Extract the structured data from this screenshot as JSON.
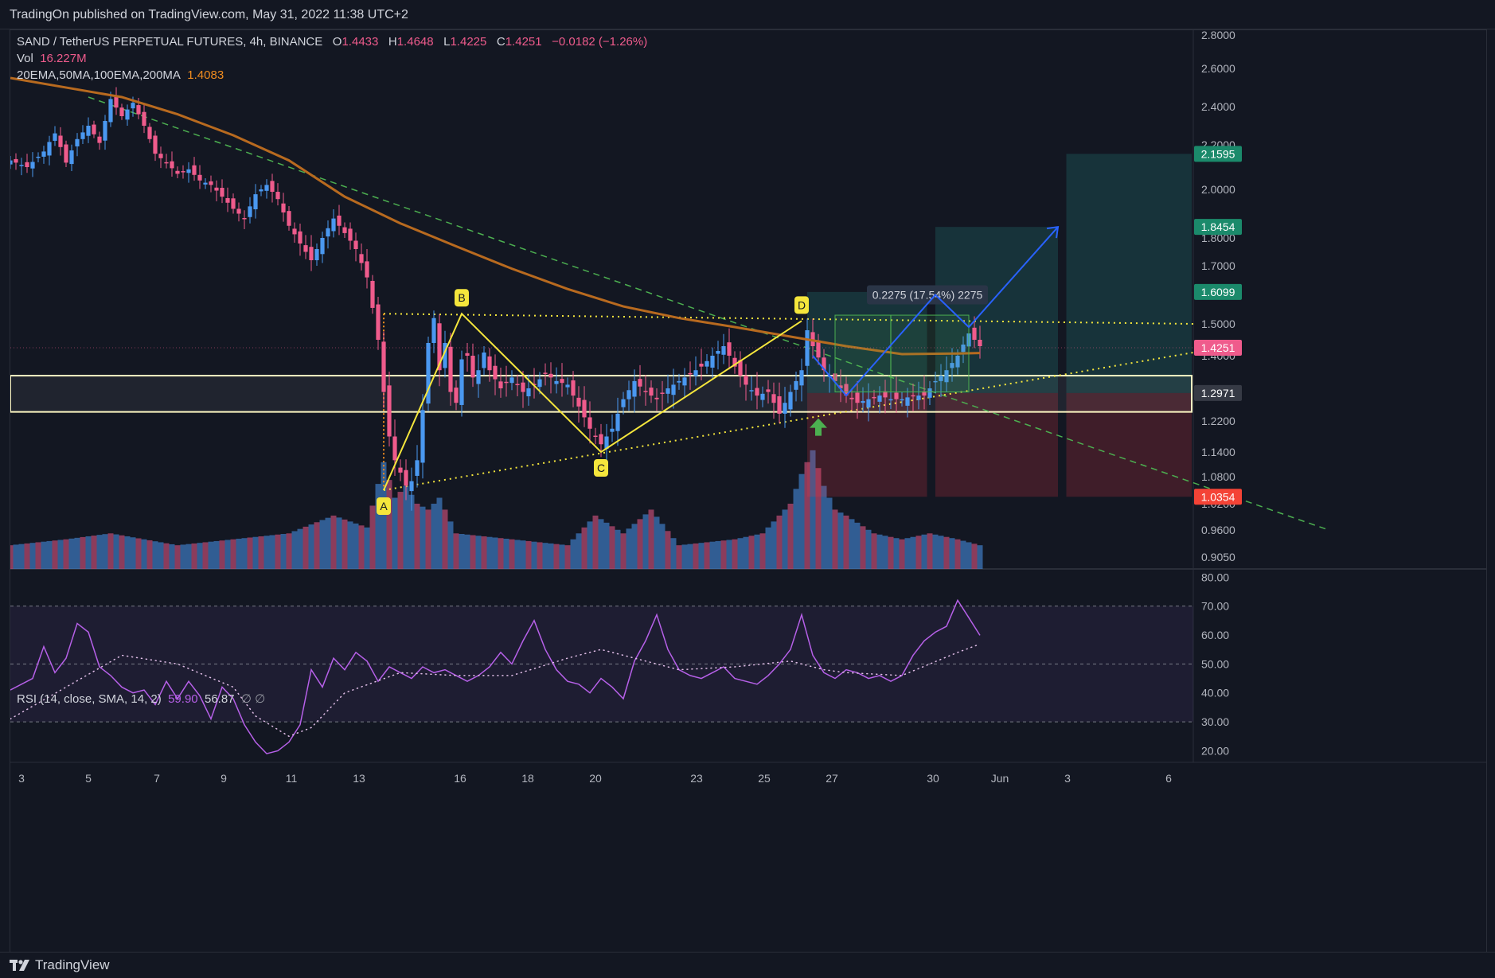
{
  "header": {
    "published_text": "TradingOn published on TradingView.com, May 31, 2022 11:38 UTC+2"
  },
  "legend": {
    "symbol": "SAND / TetherUS PERPETUAL FUTURES, 4h, BINANCE",
    "open_label": "O",
    "open": "1.4433",
    "high_label": "H",
    "high": "1.4648",
    "low_label": "L",
    "low": "1.4225",
    "close_label": "C",
    "close": "1.4251",
    "change": "−0.0182 (−1.26%)",
    "vol_label": "Vol",
    "vol_value": "16.227M",
    "ma_label": "20EMA,50MA,100EMA,200MA",
    "ma_value": "1.4083",
    "rsi_label": "RSI (14, close, SMA, 14, 2)",
    "rsi_value": "59.90",
    "rsi_ma_value": "56.87",
    "rsi_extra": "∅ ∅"
  },
  "footer": {
    "brand": "TradingView"
  },
  "colors": {
    "background": "#131722",
    "up": "#4a98f0",
    "down": "#ef5b8c",
    "ma": "#b86a1f",
    "pattern": "#f5e63c",
    "trend": "#4caf50",
    "rsi": "#b660e8",
    "projection": "#2962ff"
  },
  "chart_data": [
    {
      "type": "candlestick",
      "title": "SAND / TetherUS PERPETUAL FUTURES, 4h, BINANCE",
      "x_ticks": [
        "3",
        "5",
        "7",
        "9",
        "11",
        "13",
        "16",
        "18",
        "20",
        "23",
        "25",
        "27",
        "30",
        "Jun",
        "3",
        "6"
      ],
      "y_ticks": [
        "2.8000",
        "2.6000",
        "2.4000",
        "2.2000",
        "2.0000",
        "1.8000",
        "1.7000",
        "1.5000",
        "1.4000",
        "1.2200",
        "1.1400",
        "1.0800",
        "1.0200",
        "0.9600",
        "0.9050"
      ],
      "y_ticks_values": [
        2.8,
        2.6,
        2.4,
        2.2,
        2.0,
        1.8,
        1.7,
        1.5,
        1.4,
        1.22,
        1.14,
        1.08,
        1.02,
        0.96,
        0.905
      ],
      "ylim": [
        0.88,
        2.87
      ],
      "price_badges": [
        {
          "label": "2.1595",
          "value": 2.1595,
          "color": "#1b8a6b"
        },
        {
          "label": "1.8454",
          "value": 1.8454,
          "color": "#1b8a6b"
        },
        {
          "label": "1.6099",
          "value": 1.6099,
          "color": "#1b8a6b"
        },
        {
          "label": "1.4251",
          "value": 1.4251,
          "color": "#ef5b8c"
        },
        {
          "label": "1.2971",
          "value": 1.2971,
          "color": "#363a45"
        },
        {
          "label": "1.0354",
          "value": 1.0354,
          "color": "#f44336"
        }
      ],
      "close_path": [
        [
          0,
          2.13
        ],
        [
          3,
          2.1
        ],
        [
          6,
          2.17
        ],
        [
          8,
          2.26
        ],
        [
          10,
          2.12
        ],
        [
          12,
          2.23
        ],
        [
          14,
          2.3
        ],
        [
          16,
          2.21
        ],
        [
          18,
          2.44
        ],
        [
          20,
          2.35
        ],
        [
          22,
          2.42
        ],
        [
          24,
          2.3
        ],
        [
          26,
          2.16
        ],
        [
          28,
          2.12
        ],
        [
          30,
          2.07
        ],
        [
          32,
          2.09
        ],
        [
          34,
          2.04
        ],
        [
          36,
          2.02
        ],
        [
          38,
          1.97
        ],
        [
          40,
          1.92
        ],
        [
          42,
          1.88
        ],
        [
          44,
          1.98
        ],
        [
          46,
          2.02
        ],
        [
          48,
          1.96
        ],
        [
          50,
          1.85
        ],
        [
          52,
          1.78
        ],
        [
          54,
          1.72
        ],
        [
          56,
          1.8
        ],
        [
          58,
          1.88
        ],
        [
          60,
          1.82
        ],
        [
          62,
          1.76
        ],
        [
          64,
          1.66
        ],
        [
          66,
          1.45
        ],
        [
          67,
          1.3
        ],
        [
          68,
          1.18
        ],
        [
          69,
          1.12
        ],
        [
          70,
          1.09
        ],
        [
          71,
          1.06
        ],
        [
          72,
          1.07
        ],
        [
          73,
          1.12
        ],
        [
          74,
          1.25
        ],
        [
          75,
          1.44
        ],
        [
          76,
          1.52
        ],
        [
          77,
          1.36
        ],
        [
          78,
          1.44
        ],
        [
          79,
          1.3
        ],
        [
          80,
          1.27
        ],
        [
          81,
          1.39
        ],
        [
          82,
          1.4
        ],
        [
          83,
          1.34
        ],
        [
          84,
          1.36
        ],
        [
          85,
          1.41
        ],
        [
          86,
          1.36
        ],
        [
          88,
          1.31
        ],
        [
          90,
          1.34
        ],
        [
          92,
          1.3
        ],
        [
          94,
          1.32
        ],
        [
          96,
          1.35
        ],
        [
          98,
          1.33
        ],
        [
          100,
          1.32
        ],
        [
          102,
          1.26
        ],
        [
          104,
          1.2
        ],
        [
          106,
          1.16
        ],
        [
          108,
          1.2
        ],
        [
          110,
          1.28
        ],
        [
          112,
          1.33
        ],
        [
          114,
          1.3
        ],
        [
          116,
          1.28
        ],
        [
          118,
          1.31
        ],
        [
          120,
          1.33
        ],
        [
          122,
          1.35
        ],
        [
          124,
          1.37
        ],
        [
          126,
          1.4
        ],
        [
          128,
          1.43
        ],
        [
          130,
          1.37
        ],
        [
          132,
          1.32
        ],
        [
          134,
          1.29
        ],
        [
          136,
          1.3
        ],
        [
          138,
          1.24
        ],
        [
          140,
          1.3
        ],
        [
          142,
          1.36
        ],
        [
          143,
          1.48
        ],
        [
          144,
          1.43
        ],
        [
          146,
          1.36
        ],
        [
          148,
          1.33
        ],
        [
          150,
          1.29
        ],
        [
          152,
          1.27
        ],
        [
          154,
          1.28
        ],
        [
          156,
          1.29
        ],
        [
          158,
          1.28
        ],
        [
          160,
          1.28
        ],
        [
          162,
          1.29
        ],
        [
          164,
          1.29
        ],
        [
          166,
          1.33
        ],
        [
          168,
          1.36
        ],
        [
          170,
          1.4
        ],
        [
          172,
          1.47
        ],
        [
          174,
          1.43
        ]
      ],
      "ma200_path": [
        [
          0,
          2.55
        ],
        [
          14,
          2.48
        ],
        [
          20,
          2.45
        ],
        [
          30,
          2.36
        ],
        [
          40,
          2.25
        ],
        [
          50,
          2.13
        ],
        [
          60,
          1.97
        ],
        [
          70,
          1.86
        ],
        [
          80,
          1.77
        ],
        [
          90,
          1.69
        ],
        [
          100,
          1.62
        ],
        [
          110,
          1.56
        ],
        [
          120,
          1.52
        ],
        [
          130,
          1.49
        ],
        [
          140,
          1.46
        ],
        [
          150,
          1.43
        ],
        [
          160,
          1.405
        ],
        [
          170,
          1.407
        ],
        [
          174,
          1.4083
        ]
      ],
      "volume_path": [
        [
          0,
          0.2
        ],
        [
          10,
          0.25
        ],
        [
          18,
          0.3
        ],
        [
          30,
          0.2
        ],
        [
          40,
          0.25
        ],
        [
          50,
          0.3
        ],
        [
          58,
          0.45
        ],
        [
          64,
          0.35
        ],
        [
          67,
          0.9
        ],
        [
          69,
          0.6
        ],
        [
          71,
          0.7
        ],
        [
          73,
          0.55
        ],
        [
          75,
          0.5
        ],
        [
          77,
          0.6
        ],
        [
          80,
          0.3
        ],
        [
          90,
          0.25
        ],
        [
          100,
          0.2
        ],
        [
          105,
          0.45
        ],
        [
          110,
          0.3
        ],
        [
          115,
          0.5
        ],
        [
          120,
          0.2
        ],
        [
          130,
          0.25
        ],
        [
          135,
          0.3
        ],
        [
          140,
          0.55
        ],
        [
          142,
          0.8
        ],
        [
          144,
          1.0
        ],
        [
          146,
          0.7
        ],
        [
          148,
          0.5
        ],
        [
          150,
          0.45
        ],
        [
          155,
          0.3
        ],
        [
          160,
          0.25
        ],
        [
          165,
          0.3
        ],
        [
          170,
          0.25
        ],
        [
          174,
          0.2
        ]
      ],
      "levels": {
        "zone_top": 1.345,
        "zone_bottom": 1.245,
        "resistance_dotted": 1.535,
        "entry": 1.2971,
        "stop": 1.0354
      },
      "pattern_points": [
        {
          "label": "A",
          "value": 1.05
        },
        {
          "label": "B",
          "value": 1.535
        },
        {
          "label": "C",
          "value": 1.14
        },
        {
          "label": "D",
          "value": 1.51
        }
      ],
      "measure_label": "0.2275 (17.54%) 2275"
    },
    {
      "type": "line",
      "title": "RSI (14, close, SMA, 14, 2)",
      "y_ticks": [
        "80.00",
        "70.00",
        "60.00",
        "50.00",
        "40.00",
        "30.00",
        "20.00"
      ],
      "y_ticks_values": [
        80,
        70,
        60,
        50,
        40,
        30,
        20
      ],
      "ylim": [
        16,
        82
      ],
      "band": [
        30,
        70
      ],
      "series": [
        {
          "name": "RSI",
          "values": [
            [
              0,
              41
            ],
            [
              4,
              45
            ],
            [
              6,
              56
            ],
            [
              8,
              47
            ],
            [
              10,
              52
            ],
            [
              12,
              64
            ],
            [
              14,
              61
            ],
            [
              16,
              49
            ],
            [
              18,
              46
            ],
            [
              20,
              42
            ],
            [
              22,
              40
            ],
            [
              24,
              41
            ],
            [
              26,
              36
            ],
            [
              28,
              44
            ],
            [
              30,
              38
            ],
            [
              32,
              44
            ],
            [
              34,
              39
            ],
            [
              36,
              31
            ],
            [
              38,
              42
            ],
            [
              40,
              38
            ],
            [
              42,
              29
            ],
            [
              44,
              23
            ],
            [
              46,
              19
            ],
            [
              48,
              20
            ],
            [
              50,
              23
            ],
            [
              52,
              29
            ],
            [
              54,
              48
            ],
            [
              56,
              42
            ],
            [
              58,
              52
            ],
            [
              60,
              48
            ],
            [
              62,
              54
            ],
            [
              64,
              51
            ],
            [
              66,
              44
            ],
            [
              68,
              49
            ],
            [
              70,
              47
            ],
            [
              72,
              45
            ],
            [
              74,
              49
            ],
            [
              76,
              47
            ],
            [
              78,
              48
            ],
            [
              80,
              46
            ],
            [
              82,
              44
            ],
            [
              84,
              46
            ],
            [
              86,
              49
            ],
            [
              88,
              54
            ],
            [
              90,
              50
            ],
            [
              92,
              58
            ],
            [
              94,
              65
            ],
            [
              96,
              55
            ],
            [
              98,
              48
            ],
            [
              100,
              44
            ],
            [
              102,
              43
            ],
            [
              104,
              40
            ],
            [
              106,
              45
            ],
            [
              108,
              42
            ],
            [
              110,
              38
            ],
            [
              112,
              51
            ],
            [
              114,
              58
            ],
            [
              116,
              67
            ],
            [
              118,
              55
            ],
            [
              120,
              48
            ],
            [
              122,
              46
            ],
            [
              124,
              45
            ],
            [
              126,
              47
            ],
            [
              128,
              49
            ],
            [
              130,
              45
            ],
            [
              132,
              44
            ],
            [
              134,
              43
            ],
            [
              136,
              46
            ],
            [
              138,
              50
            ],
            [
              140,
              55
            ],
            [
              142,
              67
            ],
            [
              144,
              53
            ],
            [
              146,
              47
            ],
            [
              148,
              45
            ],
            [
              150,
              48
            ],
            [
              152,
              47
            ],
            [
              154,
              45
            ],
            [
              156,
              46
            ],
            [
              158,
              44
            ],
            [
              160,
              46
            ],
            [
              162,
              53
            ],
            [
              164,
              58
            ],
            [
              166,
              61
            ],
            [
              168,
              63
            ],
            [
              170,
              72
            ],
            [
              172,
              66
            ],
            [
              174,
              59.9
            ]
          ]
        },
        {
          "name": "RSI-based MA",
          "values": [
            [
              0,
              31
            ],
            [
              10,
              42
            ],
            [
              20,
              53
            ],
            [
              30,
              50
            ],
            [
              40,
              42
            ],
            [
              44,
              32
            ],
            [
              50,
              25
            ],
            [
              54,
              28
            ],
            [
              60,
              40
            ],
            [
              70,
              47
            ],
            [
              80,
              46
            ],
            [
              90,
              46
            ],
            [
              100,
              52
            ],
            [
              106,
              55
            ],
            [
              114,
              51
            ],
            [
              120,
              48
            ],
            [
              130,
              49
            ],
            [
              140,
              51
            ],
            [
              146,
              48
            ],
            [
              150,
              47
            ],
            [
              160,
              46
            ],
            [
              170,
              54
            ],
            [
              174,
              56.87
            ]
          ]
        }
      ]
    }
  ]
}
